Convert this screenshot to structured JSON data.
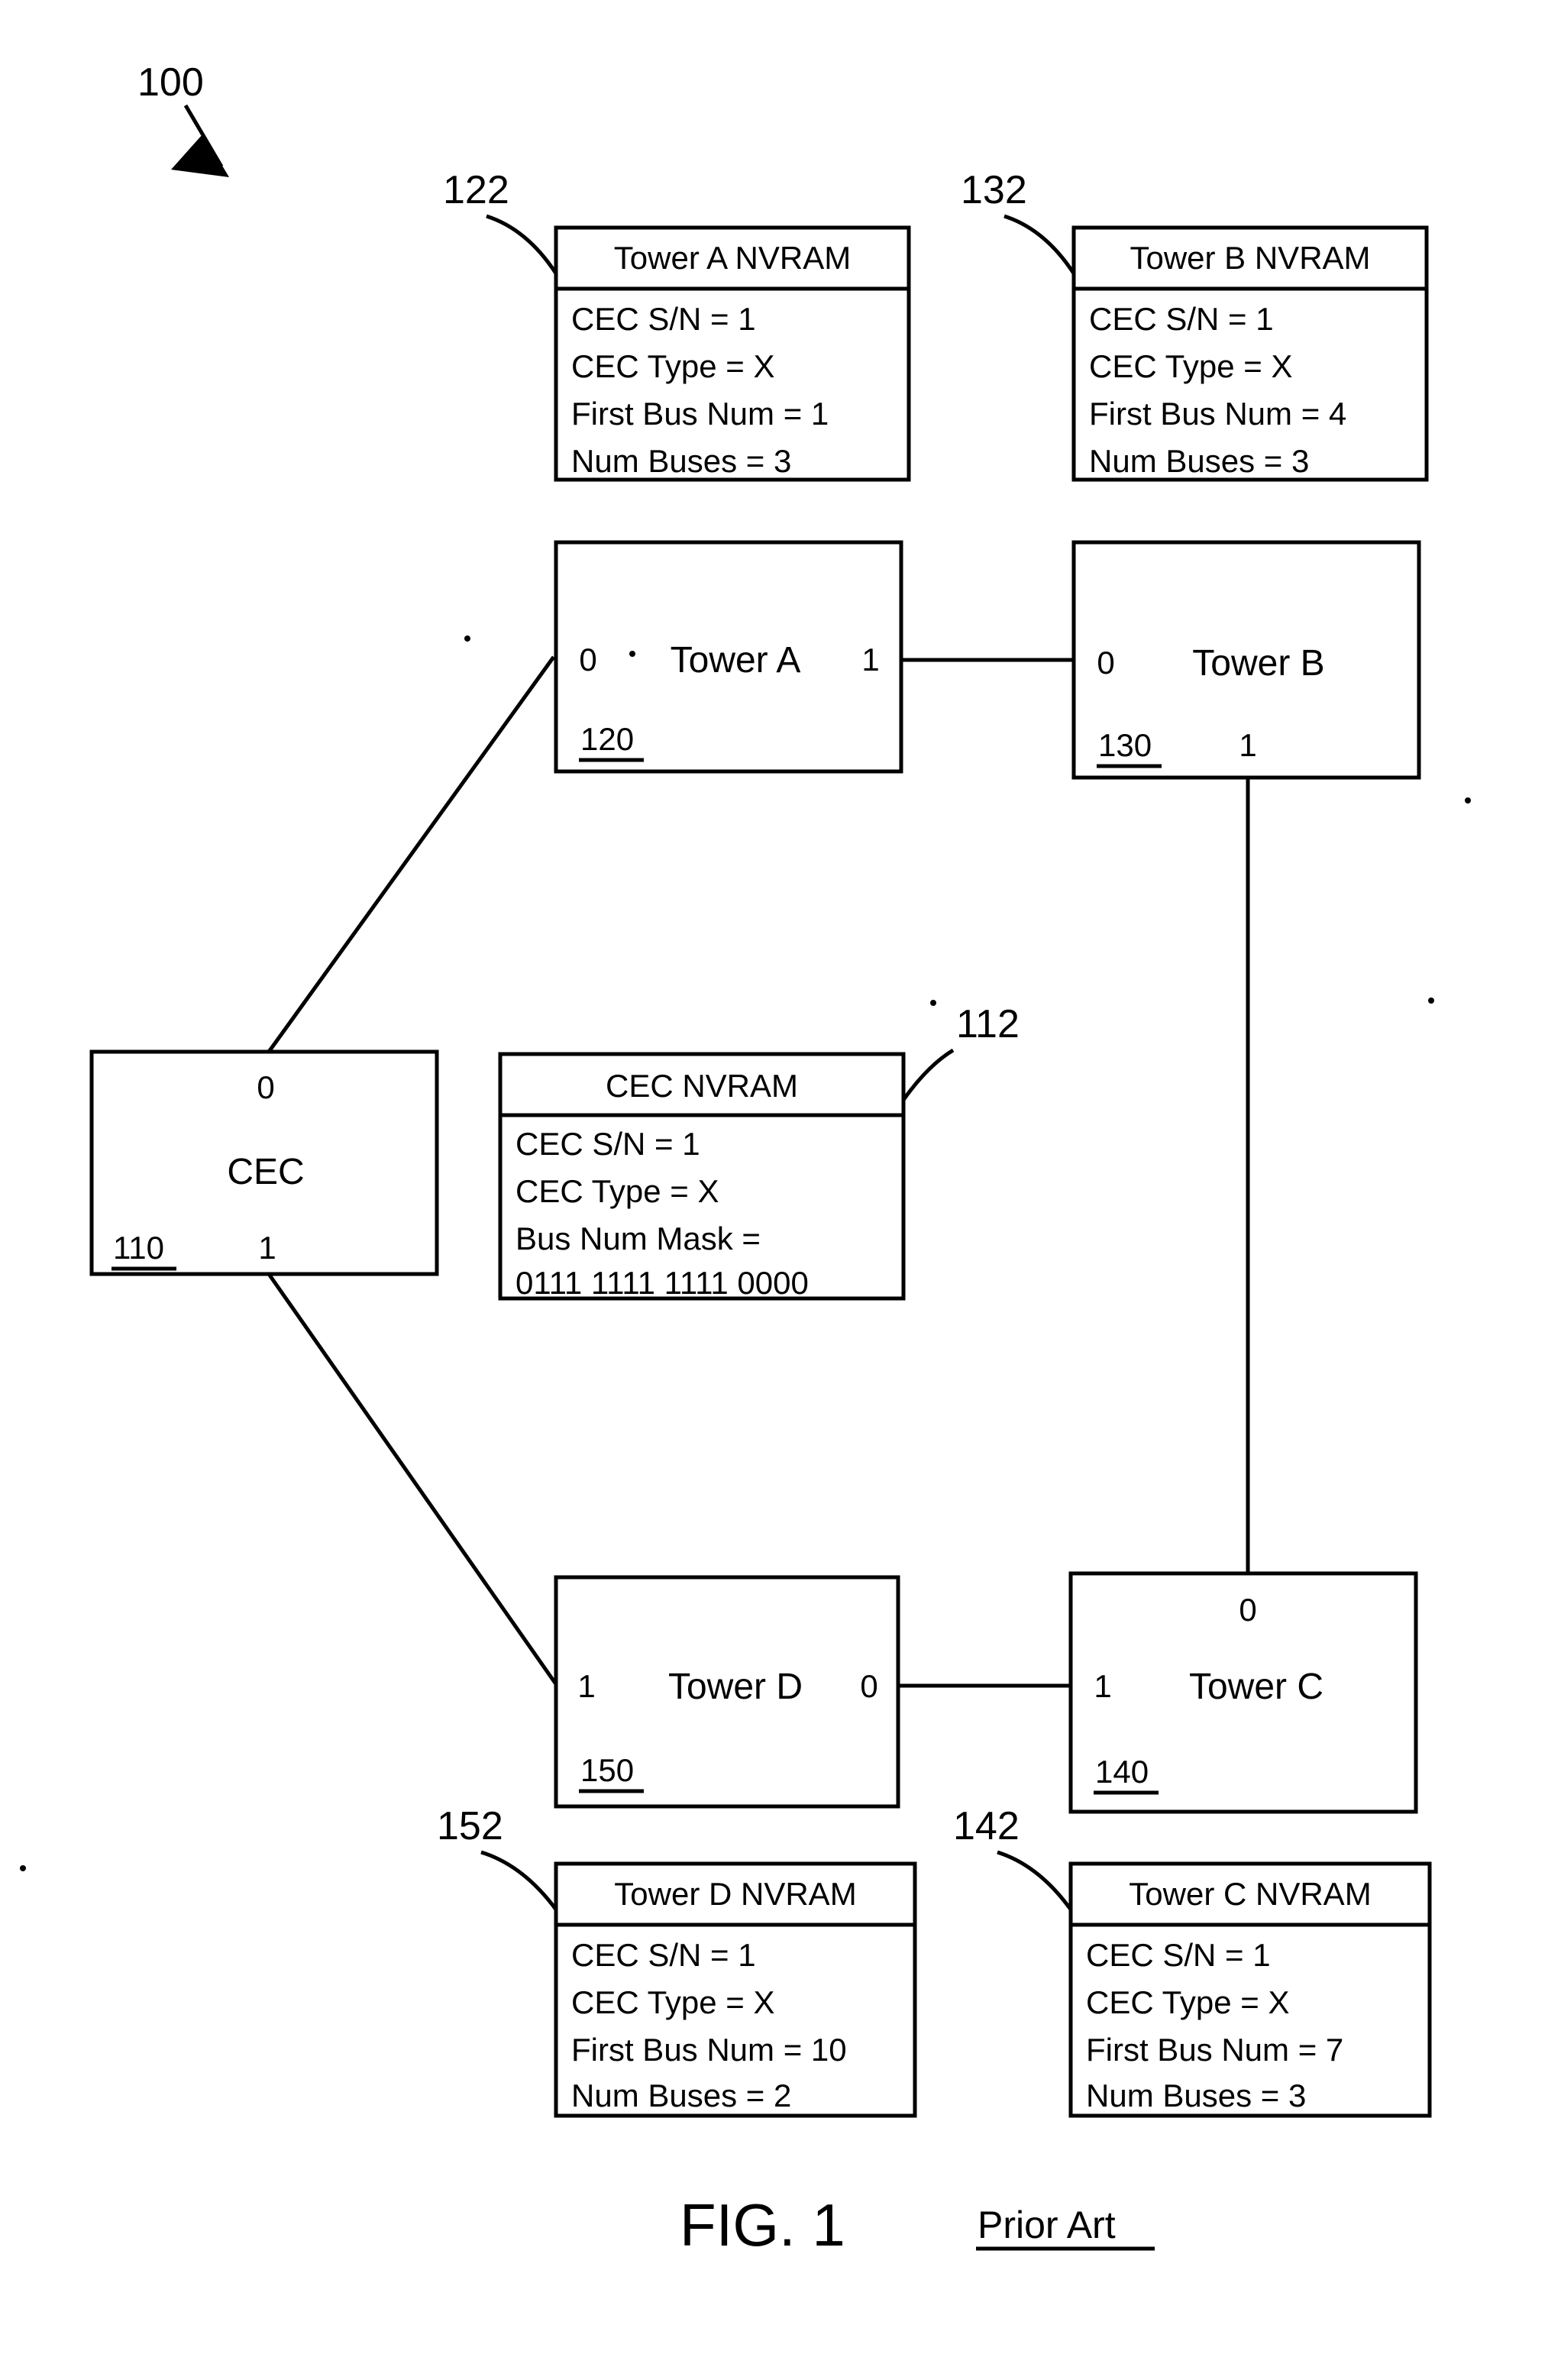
{
  "figure": {
    "label": "FIG. 1",
    "annotation": "Prior Art",
    "system_ref": "100"
  },
  "nodes": {
    "cec": {
      "name": "CEC",
      "ref": "110",
      "port_top": "0",
      "port_bottom": "1"
    },
    "tower_a": {
      "name": "Tower A",
      "ref": "120",
      "port_left": "0",
      "port_right": "1"
    },
    "tower_b": {
      "name": "Tower B",
      "ref": "130",
      "port_left": "0",
      "port_bottom": "1"
    },
    "tower_c": {
      "name": "Tower C",
      "ref": "140",
      "port_top": "0",
      "port_left": "1"
    },
    "tower_d": {
      "name": "Tower D",
      "ref": "150",
      "port_left": "1",
      "port_right": "0"
    }
  },
  "nvram": {
    "cec": {
      "title": "CEC NVRAM",
      "ref": "112",
      "lines": [
        "CEC S/N = 1",
        "CEC Type = X",
        "Bus Num Mask =",
        "0111 1111 1111 0000"
      ]
    },
    "tower_a": {
      "title": "Tower A NVRAM",
      "ref": "122",
      "lines": [
        "CEC S/N = 1",
        "CEC Type = X",
        "First Bus Num = 1",
        "Num Buses = 3"
      ]
    },
    "tower_b": {
      "title": "Tower B NVRAM",
      "ref": "132",
      "lines": [
        "CEC S/N = 1",
        "CEC Type = X",
        "First Bus Num = 4",
        "Num Buses = 3"
      ]
    },
    "tower_c": {
      "title": "Tower C NVRAM",
      "ref": "142",
      "lines": [
        "CEC S/N = 1",
        "CEC Type = X",
        "First Bus Num = 7",
        "Num Buses = 3"
      ]
    },
    "tower_d": {
      "title": "Tower D NVRAM",
      "ref": "152",
      "lines": [
        "CEC S/N = 1",
        "CEC Type = X",
        "First Bus Num = 10",
        "Num Buses = 2"
      ]
    }
  }
}
